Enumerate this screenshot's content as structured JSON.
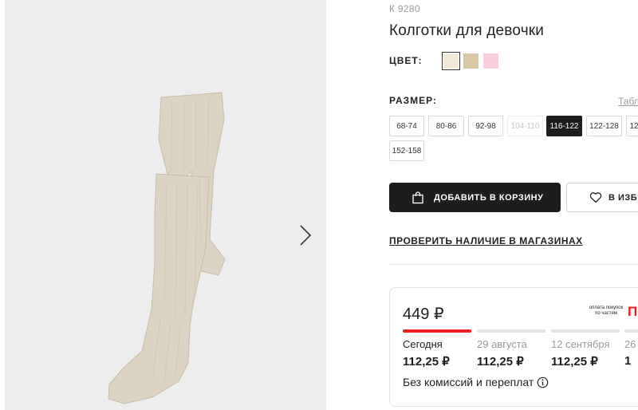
{
  "product": {
    "sku": "К 9280",
    "title": "Колготки для девочки"
  },
  "gallery": {
    "next_icon": "chevron-right-icon"
  },
  "colors": {
    "label": "ЦВЕТ:",
    "swatches": [
      {
        "name": "cream",
        "hex": "#f1e8d8",
        "selected": true
      },
      {
        "name": "beige",
        "hex": "#d8c8a3",
        "selected": false
      },
      {
        "name": "pink",
        "hex": "#f9cfe0",
        "selected": false
      }
    ]
  },
  "sizes": {
    "label": "РАЗМЕР:",
    "table_link": "Табл",
    "items": [
      {
        "label": "68-74",
        "state": "available"
      },
      {
        "label": "80-86",
        "state": "available"
      },
      {
        "label": "92-98",
        "state": "available"
      },
      {
        "label": "104-110",
        "state": "disabled"
      },
      {
        "label": "116-122",
        "state": "selected"
      },
      {
        "label": "122-128",
        "state": "available"
      },
      {
        "label": "12",
        "state": "available"
      },
      {
        "label": "152-158",
        "state": "available"
      }
    ]
  },
  "actions": {
    "add_to_cart": "ДОБАВИТЬ В КОРЗИНУ",
    "add_to_cart_icon": "shopping-bag-icon",
    "favorites": "В ИЗБР",
    "favorites_icon": "heart-icon",
    "check_stores": "ПРОВЕРИТЬ НАЛИЧИЕ В МАГАЗИНАХ"
  },
  "payment": {
    "price": "449 ₽",
    "note": "оплата покупок по частям",
    "logo_text": "П",
    "installments": [
      {
        "date": "Сегодня",
        "amount": "112,25 ₽",
        "active": true
      },
      {
        "date": "29 августа",
        "amount": "112,25 ₽",
        "active": false
      },
      {
        "date": "12 сентября",
        "amount": "112,25 ₽",
        "active": false
      },
      {
        "date": "26",
        "amount": "1",
        "active": false
      }
    ],
    "no_fees": "Без комиссий и переплат",
    "info_icon": "info-icon"
  },
  "colors_theme": {
    "accent": "#ee1d23",
    "dark": "#1d1d1d"
  }
}
